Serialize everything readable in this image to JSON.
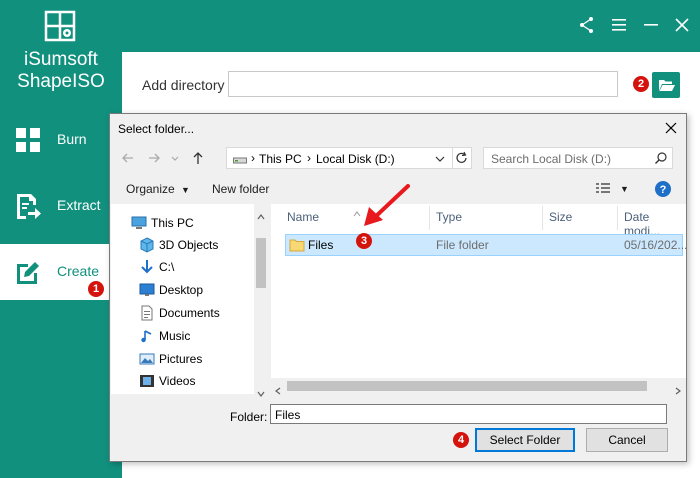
{
  "app": {
    "name_line1": "iSumsoft",
    "name_line2": "ShapeISO",
    "brand_color": "#11907e",
    "logo_icon": "disc-image-icon"
  },
  "sidebar": {
    "items": [
      {
        "label": "Burn",
        "icon": "burn-grid-icon",
        "active": false
      },
      {
        "label": "Extract",
        "icon": "extract-icon",
        "active": false
      },
      {
        "label": "Create",
        "icon": "create-edit-icon",
        "active": true
      }
    ]
  },
  "header": {
    "buttons": [
      "share-icon",
      "menu-icon",
      "minimize-icon",
      "close-icon"
    ]
  },
  "add_directory": {
    "label": "Add directory",
    "value": "",
    "browse_icon": "folder-open-icon"
  },
  "steps": [
    "1",
    "2",
    "3",
    "4"
  ],
  "dialog": {
    "title": "Select folder...",
    "address": {
      "drive_icon": "drive-icon",
      "crumbs": [
        "This PC",
        "Local Disk (D:)"
      ]
    },
    "search_placeholder": "Search Local Disk (D:)",
    "toolbar": {
      "organize": "Organize",
      "new_folder": "New folder",
      "view_icon": "view-details-icon",
      "help_icon": "help-icon"
    },
    "tree": [
      {
        "label": "This PC",
        "icon": "computer-icon"
      },
      {
        "label": "3D Objects",
        "icon": "cube-icon"
      },
      {
        "label": "C:\\",
        "icon": "arrow-down-icon"
      },
      {
        "label": "Desktop",
        "icon": "desktop-icon"
      },
      {
        "label": "Documents",
        "icon": "document-icon"
      },
      {
        "label": "Music",
        "icon": "music-icon"
      },
      {
        "label": "Pictures",
        "icon": "picture-icon"
      },
      {
        "label": "Videos",
        "icon": "video-icon"
      }
    ],
    "columns": [
      "Name",
      "Type",
      "Size",
      "Date modi..."
    ],
    "files": [
      {
        "name": "Files",
        "type": "File folder",
        "size": "",
        "date": "05/16/202..."
      }
    ],
    "folder_label": "Folder:",
    "folder_value": "Files",
    "select_button": "Select Folder",
    "cancel_button": "Cancel"
  },
  "colors": {
    "badge": "#d4140c",
    "selection": "#cce8ff",
    "arrow": "#e8191e"
  }
}
